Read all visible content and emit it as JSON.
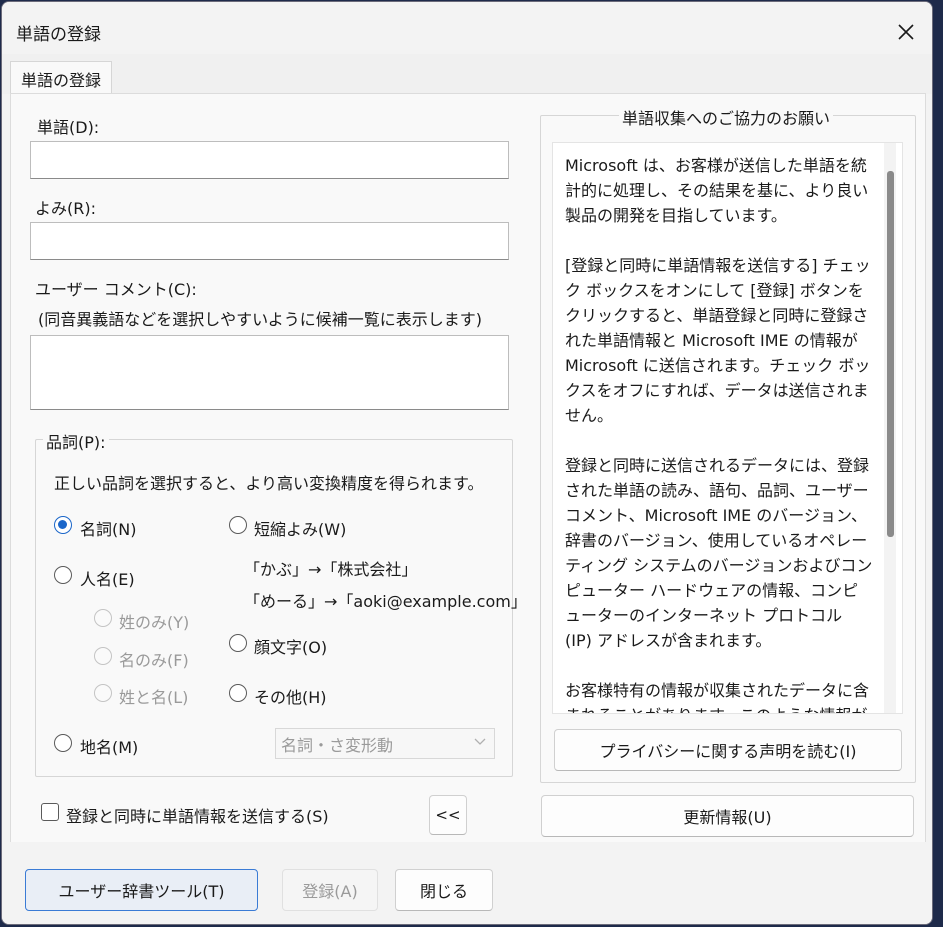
{
  "window": {
    "title": "単語の登録",
    "close_icon": "close-icon"
  },
  "tabs": [
    {
      "label": "単語の登録",
      "selected": true
    }
  ],
  "form": {
    "word_label": "単語(D):",
    "word_value": "",
    "reading_label": "よみ(R):",
    "reading_value": "",
    "comment_label": "ユーザー コメント(C):",
    "comment_hint": "(同音異義語などを選択しやすいように候補一覧に表示します)",
    "comment_value": ""
  },
  "pos": {
    "legend": "品詞(P):",
    "description": "正しい品詞を選択すると、より高い変換精度を得られます。",
    "noun": "名詞(N)",
    "person_name": "人名(E)",
    "surname_only": "姓のみ(Y)",
    "given_only": "名のみ(F)",
    "surname_and_given": "姓と名(L)",
    "place_name": "地名(M)",
    "abbreviation": "短縮よみ(W)",
    "abbr_example1": "「かぶ」→「株式会社」",
    "abbr_example2": "「めーる」→「aoki@example.com」",
    "emoticon": "顔文字(O)",
    "other": "その他(H)",
    "other_select_value": "名詞・さ変形動",
    "selected": "noun"
  },
  "send_checkbox": {
    "label": "登録と同時に単語情報を送信する(S)",
    "checked": false
  },
  "collapse_button": "<<",
  "info": {
    "legend": "単語収集へのご協力のお願い",
    "paragraphs": [
      "Microsoft は、お客様が送信した単語を統計的に処理し、その結果を基に、より良い製品の開発を目指しています。",
      "[登録と同時に単語情報を送信する] チェック ボックスをオンにして [登録] ボタンをクリックすると、単語登録と同時に登録された単語情報と Microsoft IME の情報が Microsoft に送信されます。チェック ボックスをオフにすれば、データは送信されません。",
      "登録と同時に送信されるデータには、登録された単語の読み、語句、品詞、ユーザー コメント、Microsoft IME のバージョン、辞書のバージョン、使用しているオペレーティング システムのバージョンおよびコンピューター ハードウェアの情報、コンピューターのインターネット プロトコル (IP) アドレスが含まれます。",
      "お客様特有の情報が収集されたデータに含まれることがあります。このような情報が存在する場合でも、Microsoft では、お客様を特定するために使用することはありません。"
    ],
    "privacy_button": "プライバシーに関する声明を読む(I)"
  },
  "update_button": "更新情報(U)",
  "footer": {
    "user_dict_tool": "ユーザー辞書ツール(T)",
    "register": "登録(A)",
    "close": "閉じる"
  },
  "colors": {
    "accent": "#1b66c9",
    "background": "#f3f3f3"
  }
}
